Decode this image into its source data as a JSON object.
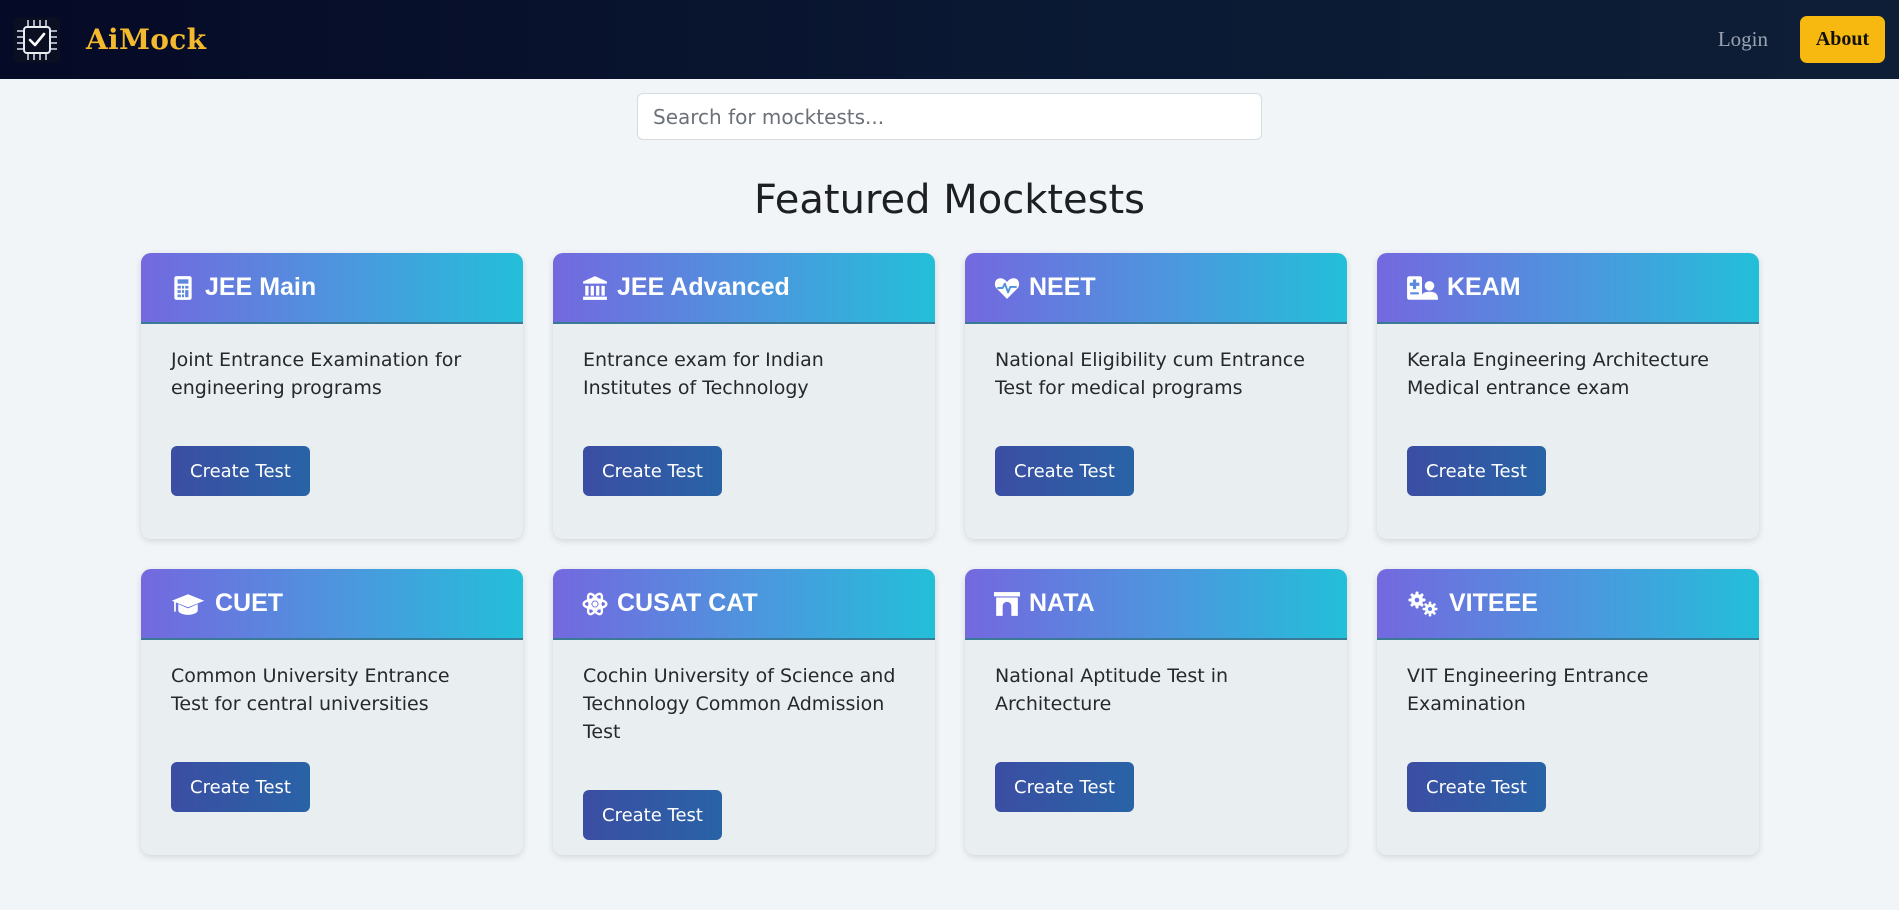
{
  "nav": {
    "brand": "AiMock",
    "logo_icon": "chip-check-icon",
    "login_label": "Login",
    "about_label": "About",
    "accent_color": "#f7b90f"
  },
  "search": {
    "placeholder": "Search for mocktests...",
    "value": ""
  },
  "main": {
    "title": "Featured Mocktests",
    "cards": [
      {
        "title": "JEE Main",
        "icon": "calculator-icon",
        "description": "Joint Entrance Examination for engineering programs",
        "button_label": "Create Test"
      },
      {
        "title": "JEE Advanced",
        "icon": "institution-icon",
        "description": "Entrance exam for Indian Institutes of Technology",
        "button_label": "Create Test"
      },
      {
        "title": "NEET",
        "icon": "heartbeat-icon",
        "description": "National Eligibility cum Entrance Test for medical programs",
        "button_label": "Create Test"
      },
      {
        "title": "KEAM",
        "icon": "user-doctor-icon",
        "description": "Kerala Engineering Architecture Medical entrance exam",
        "button_label": "Create Test"
      },
      {
        "title": "CUET",
        "icon": "graduation-cap-icon",
        "description": "Common University Entrance Test for central universities",
        "button_label": "Create Test"
      },
      {
        "title": "CUSAT CAT",
        "icon": "atom-icon",
        "description": "Cochin University of Science and Technology Common Admission Test",
        "button_label": "Create Test"
      },
      {
        "title": "NATA",
        "icon": "archway-icon",
        "description": "National Aptitude Test in Architecture",
        "button_label": "Create Test"
      },
      {
        "title": "VITEEE",
        "icon": "gears-icon",
        "description": "VIT Engineering Entrance Examination",
        "button_label": "Create Test"
      }
    ]
  }
}
